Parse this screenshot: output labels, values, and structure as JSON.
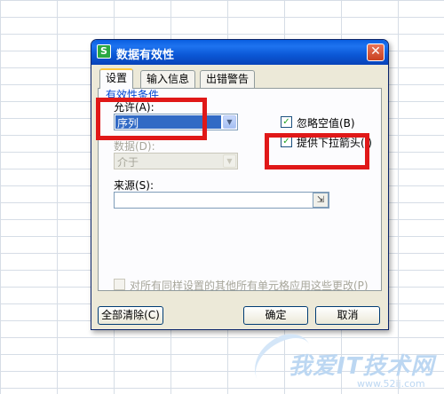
{
  "dialog": {
    "title": "数据有效性",
    "app_icon_letter": "S",
    "close_symbol": "✕"
  },
  "tabs": [
    {
      "label": "设置",
      "active": true
    },
    {
      "label": "输入信息",
      "active": false
    },
    {
      "label": "出错警告",
      "active": false
    }
  ],
  "settings": {
    "group_label": "有效性条件",
    "allow_label": "允许(A):",
    "allow_value": "序列",
    "data_label": "数据(D):",
    "data_value": "介于",
    "ignore_blank_label": "忽略空值(B)",
    "ignore_blank_checked": true,
    "dropdown_label": "提供下拉箭头(I)",
    "dropdown_checked": true,
    "source_label": "来源(S):",
    "source_value": "",
    "apply_all_label": "对所有同样设置的其他所有单元格应用这些更改(P)",
    "apply_all_checked": false
  },
  "buttons": {
    "clear_all": "全部清除(C)",
    "ok": "确定",
    "cancel": "取消"
  },
  "icons": {
    "dropdown_arrow": "▼",
    "check": "✓",
    "picker": "⇲"
  },
  "colors": {
    "titlebar": "#0a5fe0",
    "highlight": "#e01818",
    "selection": "#316ac5"
  },
  "watermark": {
    "text": "我爱IT技术网",
    "url": "www.52ij.com"
  }
}
